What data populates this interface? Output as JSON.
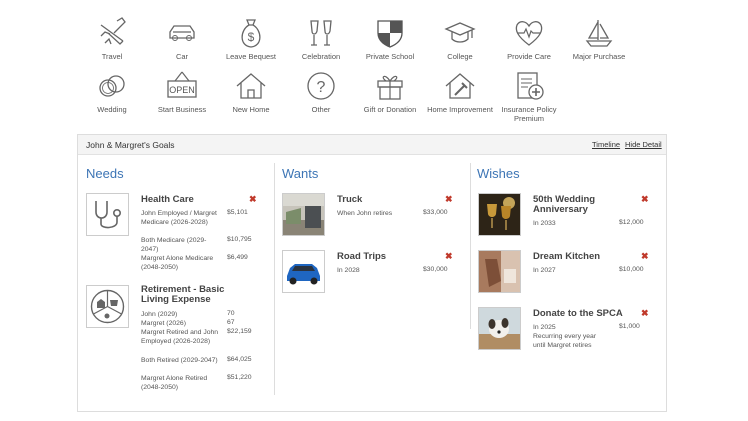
{
  "categories": [
    {
      "label": "Travel",
      "icon": "airplane-icon"
    },
    {
      "label": "Car",
      "icon": "car-icon"
    },
    {
      "label": "Leave Bequest",
      "icon": "money-bag-icon"
    },
    {
      "label": "Celebration",
      "icon": "champagne-glasses-icon"
    },
    {
      "label": "Private School",
      "icon": "shield-icon"
    },
    {
      "label": "College",
      "icon": "graduation-cap-icon"
    },
    {
      "label": "Provide Care",
      "icon": "heart-pulse-icon"
    },
    {
      "label": "Major Purchase",
      "icon": "sailboat-icon"
    },
    {
      "label": "Wedding",
      "icon": "rings-icon"
    },
    {
      "label": "Start Business",
      "icon": "open-sign-icon"
    },
    {
      "label": "New Home",
      "icon": "house-icon"
    },
    {
      "label": "Other",
      "icon": "question-icon"
    },
    {
      "label": "Gift or Donation",
      "icon": "gift-icon"
    },
    {
      "label": "Home Improvement",
      "icon": "house-hammer-icon"
    },
    {
      "label": "Insurance Policy Premium",
      "icon": "policy-document-icon"
    }
  ],
  "panel": {
    "title": "John & Margret's Goals",
    "timeline_link": "Timeline",
    "hide_detail_link": "Hide Detail",
    "open_sign_text": "OPEN"
  },
  "needs": {
    "heading": "Needs",
    "health_care": {
      "title": "Health Care",
      "rows": [
        {
          "label": "John Employed / Margret Medicare (2026-2028)",
          "value": "$5,101"
        },
        {
          "label": "Both Medicare (2029-2047)",
          "value": "$10,795"
        },
        {
          "label": "Margret Alone Medicare (2048-2050)",
          "value": "$6,499"
        }
      ]
    },
    "retirement": {
      "title": "Retirement - Basic Living Expense",
      "rows": [
        {
          "label": "John (2029)",
          "value": "70"
        },
        {
          "label": "Margret (2026)",
          "value": "67"
        },
        {
          "label": "Margret Retired and John Employed (2026-2028)",
          "value": "$22,159"
        },
        {
          "label": "Both Retired (2029-2047)",
          "value": "$64,025"
        },
        {
          "label": "Margret Alone Retired (2048-2050)",
          "value": "$51,220"
        }
      ]
    }
  },
  "wants": {
    "heading": "Wants",
    "truck": {
      "title": "Truck",
      "when": "When John retires",
      "value": "$33,000"
    },
    "road_trips": {
      "title": "Road Trips",
      "when": "In 2028",
      "value": "$30,000"
    }
  },
  "wishes": {
    "heading": "Wishes",
    "anniversary": {
      "title": "50th Wedding Anniversary",
      "when": "In 2033",
      "value": "$12,000"
    },
    "kitchen": {
      "title": "Dream Kitchen",
      "when": "In 2027",
      "value": "$10,000"
    },
    "spca": {
      "title": "Donate to the SPCA",
      "when": "In 2025",
      "value": "$1,000",
      "note": "Recurring every year until Margret retires"
    }
  },
  "delete_glyph": "✖",
  "colors": {
    "accent": "#3d75b5",
    "delete": "#c0392b"
  }
}
